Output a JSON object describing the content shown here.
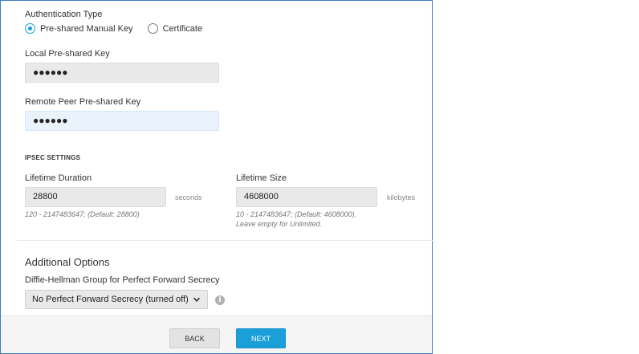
{
  "auth": {
    "label": "Authentication Type",
    "options": [
      {
        "label": "Pre-shared Manual Key",
        "selected": true
      },
      {
        "label": "Certificate",
        "selected": false
      }
    ]
  },
  "local_key": {
    "label": "Local Pre-shared Key",
    "value": "●●●●●●"
  },
  "remote_key": {
    "label": "Remote Peer Pre-shared Key",
    "value": "●●●●●●"
  },
  "ipsec": {
    "title": "IPSEC SETTINGS",
    "duration": {
      "label": "Lifetime Duration",
      "value": "28800",
      "unit": "seconds",
      "hint": "120 - 2147483647; (Default: 28800)"
    },
    "size": {
      "label": "Lifetime Size",
      "value": "4608000",
      "unit": "kilobytes",
      "hint_line1": "10 - 2147483647; (Default: 4608000).",
      "hint_line2": "Leave empty for Unlimited."
    }
  },
  "additional": {
    "title": "Additional Options",
    "dh_label": "Diffie-Hellman Group for Perfect Forward Secrecy",
    "dh_value": "No Perfect Forward Secrecy (turned off)",
    "info_glyph": "i"
  },
  "footer": {
    "back_label": "BACK",
    "next_label": "NEXT"
  },
  "colors": {
    "accent": "#1b9fd8",
    "frame_border": "#3a7fc0"
  }
}
